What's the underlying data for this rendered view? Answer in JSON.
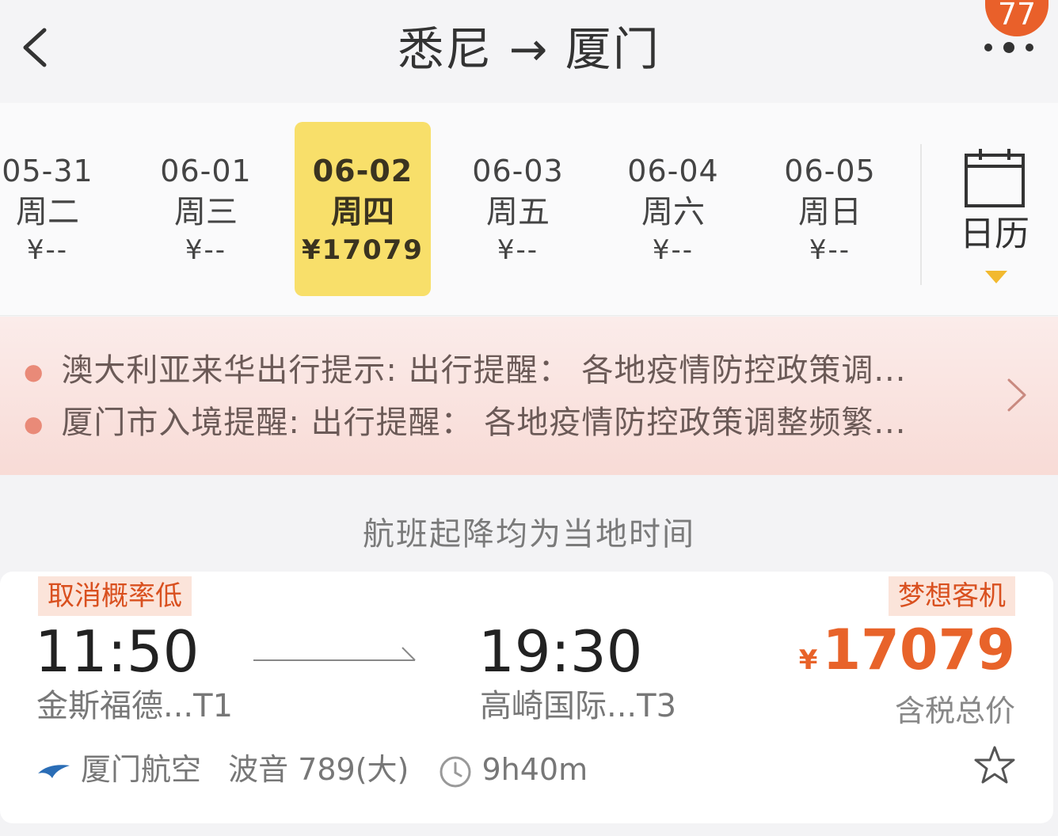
{
  "header": {
    "title": "悉尼 → 厦门",
    "badge": "77",
    "back_icon": "chevron-left-icon",
    "more_icon": "more-dots-icon"
  },
  "dates": [
    {
      "date": "05-31",
      "weekday": "周二",
      "price": "¥--",
      "selected": false
    },
    {
      "date": "06-01",
      "weekday": "周三",
      "price": "¥--",
      "selected": false
    },
    {
      "date": "06-02",
      "weekday": "周四",
      "price": "¥17079",
      "selected": true
    },
    {
      "date": "06-03",
      "weekday": "周五",
      "price": "¥--",
      "selected": false
    },
    {
      "date": "06-04",
      "weekday": "周六",
      "price": "¥--",
      "selected": false
    },
    {
      "date": "06-05",
      "weekday": "周日",
      "price": "¥--",
      "selected": false
    }
  ],
  "calendar": {
    "label": "日历",
    "icon": "calendar-icon"
  },
  "notices": [
    "澳大利亚来华出行提示: 出行提醒： 各地疫情防控政策调...",
    "厦门市入境提醒: 出行提醒： 各地疫情防控政策调整频繁..."
  ],
  "local_time_note": "航班起降均为当地时间",
  "flight": {
    "tag_left": "取消概率低",
    "tag_right": "梦想客机",
    "dep_time": "11:50",
    "arr_time": "19:30",
    "dep_airport": "金斯福德...T1",
    "arr_airport": "高崎国际...T3",
    "currency": "¥",
    "price": "17079",
    "price_note": "含税总价",
    "airline": "厦门航空",
    "aircraft": "波音 789(大)",
    "duration": "9h40m"
  },
  "colors": {
    "accent_orange": "#e8632a",
    "selected_date_bg": "#f8df6a",
    "notice_bg": "#fbecea"
  }
}
